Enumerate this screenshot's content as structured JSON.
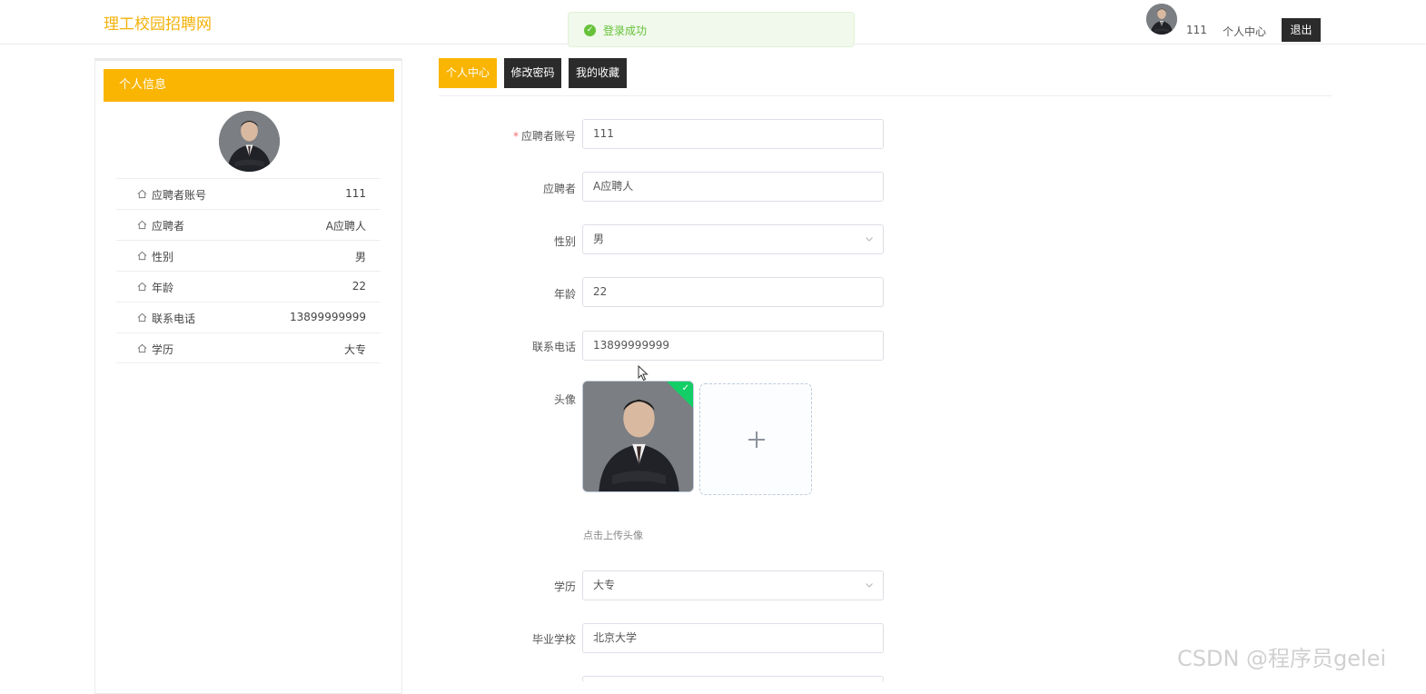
{
  "header": {
    "site_title": "理工校园招聘网",
    "toast_text": "登录成功",
    "username": "111",
    "user_center_label": "个人中心",
    "logout_label": "退出"
  },
  "sidebar": {
    "title": "个人信息",
    "rows": [
      {
        "key": "应聘者账号",
        "value": "111"
      },
      {
        "key": "应聘者",
        "value": "A应聘人"
      },
      {
        "key": "性别",
        "value": "男"
      },
      {
        "key": "年龄",
        "value": "22"
      },
      {
        "key": "联系电话",
        "value": "13899999999"
      },
      {
        "key": "学历",
        "value": "大专"
      }
    ]
  },
  "tabs": [
    {
      "label": "个人中心",
      "active": true
    },
    {
      "label": "修改密码",
      "active": false
    },
    {
      "label": "我的收藏",
      "active": false
    }
  ],
  "form": {
    "account": {
      "label": "应聘者账号",
      "value": "111",
      "required": "*"
    },
    "name": {
      "label": "应聘者",
      "value": "A应聘人"
    },
    "gender": {
      "label": "性别",
      "value": "男"
    },
    "age": {
      "label": "年龄",
      "value": "22"
    },
    "phone": {
      "label": "联系电话",
      "value": "13899999999"
    },
    "avatar": {
      "label": "头像",
      "tip": "点击上传头像"
    },
    "education": {
      "label": "学历",
      "value": "大专"
    },
    "school": {
      "label": "毕业学校",
      "value": "北京大学"
    }
  },
  "watermark": "CSDN @程序员gelei",
  "colors": {
    "accent": "#fab503",
    "dark": "#2b2b2b",
    "success": "#67c23a"
  }
}
